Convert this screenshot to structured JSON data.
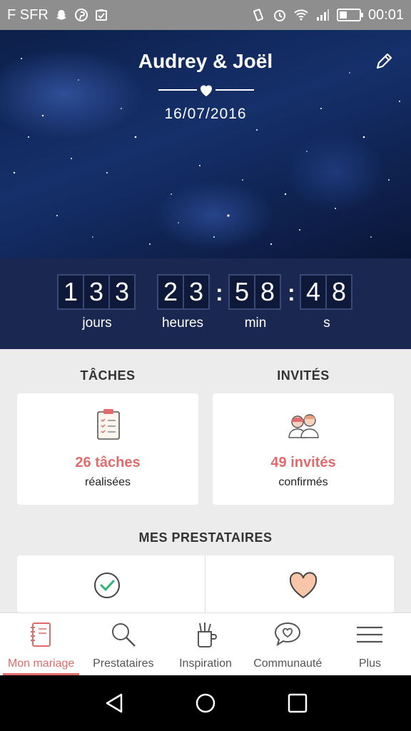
{
  "status_bar": {
    "carrier": "F SFR",
    "time": "00:01",
    "battery_level": 0.4,
    "left_icons": [
      "snapchat-icon",
      "pinterest-icon",
      "clipboard-icon"
    ],
    "right_icons": [
      "vibrate-icon",
      "alarm-icon",
      "wifi-icon",
      "signal-icon",
      "battery-icon"
    ]
  },
  "hero": {
    "couple_name": "Audrey & Joël",
    "date": "16/07/2016",
    "edit_icon": "pencil-icon"
  },
  "countdown": {
    "days": [
      "1",
      "3",
      "3"
    ],
    "hours": [
      "2",
      "3"
    ],
    "minutes": [
      "5",
      "8"
    ],
    "seconds": [
      "4",
      "8"
    ],
    "labels": {
      "days": "jours",
      "hours": "heures",
      "minutes": "min",
      "seconds": "s"
    }
  },
  "tasks": {
    "title": "TÂCHES",
    "count": "26 tâches",
    "sub": "réalisées",
    "icon": "clipboard-checklist-icon"
  },
  "guests": {
    "title": "INVITÉS",
    "count": "49 invités",
    "sub": "confirmés",
    "icon": "couple-icon"
  },
  "vendors": {
    "title": "MES PRESTATAIRES",
    "left_icon": "check-circle-icon",
    "right_icon": "heart-icon"
  },
  "bottom_nav": {
    "items": [
      {
        "label": "Mon mariage",
        "icon": "notebook-icon",
        "active": true
      },
      {
        "label": "Prestataires",
        "icon": "search-icon",
        "active": false
      },
      {
        "label": "Inspiration",
        "icon": "inspiration-cup-icon",
        "active": false
      },
      {
        "label": "Communauté",
        "icon": "chat-heart-icon",
        "active": false
      },
      {
        "label": "Plus",
        "icon": "menu-icon",
        "active": false
      }
    ]
  },
  "colors": {
    "accent": "#e06b6b",
    "countdown_bg": "#1a2750",
    "status_bar": "#8e8e8e"
  }
}
